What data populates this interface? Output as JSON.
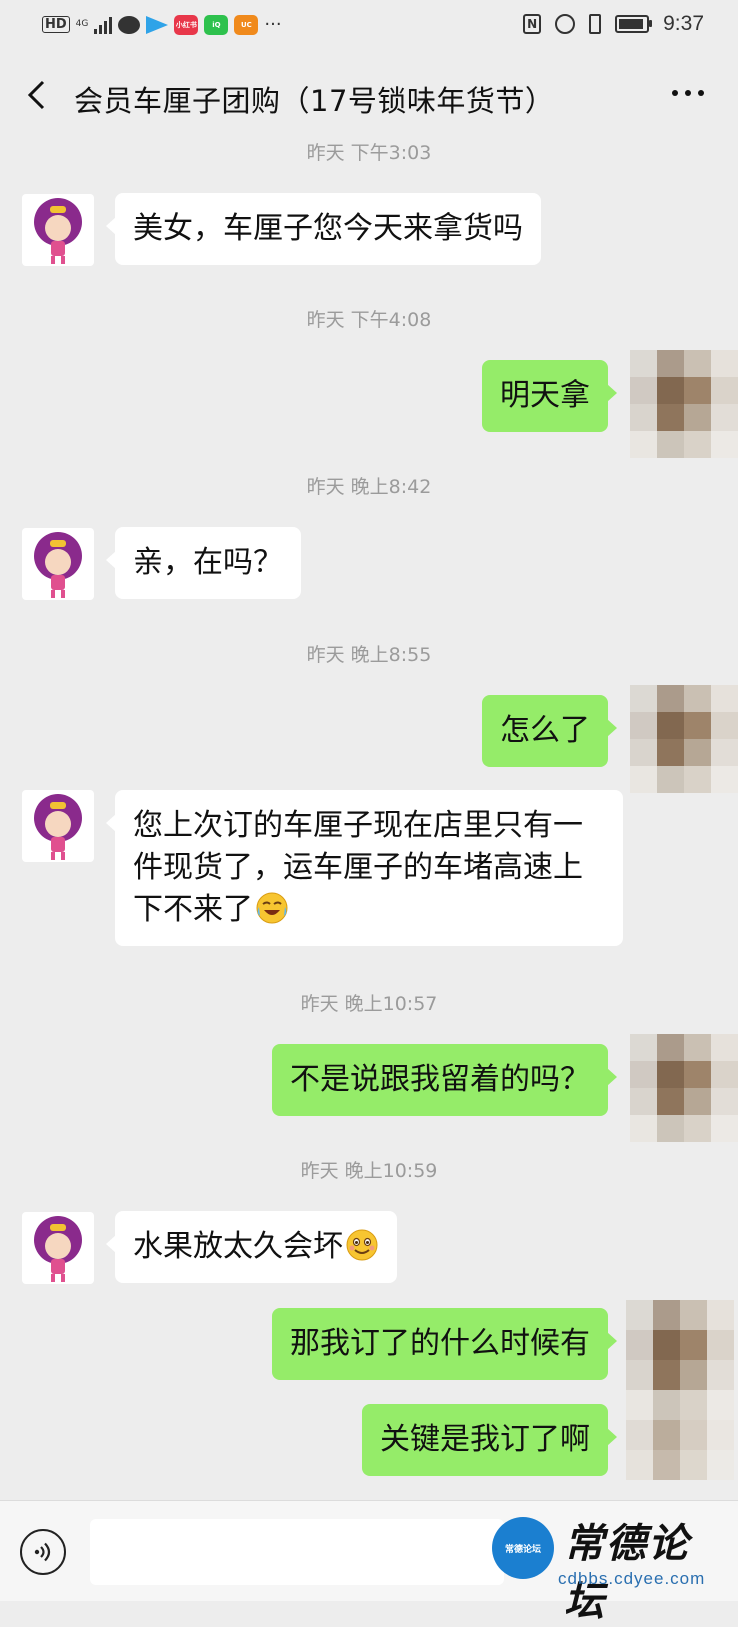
{
  "status_bar": {
    "hd": "HD",
    "network": "4G",
    "time": "9:37",
    "apps": [
      "chat-app",
      "direct-app",
      "xiaohongshu-app",
      "iqiyi-app",
      "uc-browser-app"
    ],
    "more": "···"
  },
  "nav": {
    "title": "会员车厘子团购（17号锁味年货节）"
  },
  "timestamps": {
    "t1": "昨天 下午3:03",
    "t2": "昨天 下午4:08",
    "t3": "昨天 晚上8:42",
    "t4": "昨天 晚上8:55",
    "t5": "昨天 晚上10:57",
    "t6": "昨天 晚上10:59"
  },
  "messages": {
    "m1": "美女，车厘子您今天来拿货吗",
    "m2": "明天拿",
    "m3": "亲，在吗？",
    "m4": "怎么了",
    "m5_line1": "您上次订的车厘子现在店里只有一",
    "m5_line2": "件现货了，运车厘子的车堵高速上",
    "m5_line3": "下不来了",
    "m6": "不是说跟我留着的吗？",
    "m7": "水果放太久会坏",
    "m8": "那我订了的什么时候有",
    "m9": "关键是我订了啊"
  },
  "emojis": {
    "m5": "laugh-cry-emoji",
    "m7": "smile-emoji"
  },
  "input": {
    "placeholder": ""
  },
  "watermark": {
    "title": "常德论坛",
    "url": "cdbbs.cdyee.com",
    "logo_text": "常德论坛"
  },
  "colors": {
    "background": "#ededed",
    "incoming_bubble": "#ffffff",
    "outgoing_bubble": "#95ec69",
    "timestamp": "#9b9b9b"
  }
}
